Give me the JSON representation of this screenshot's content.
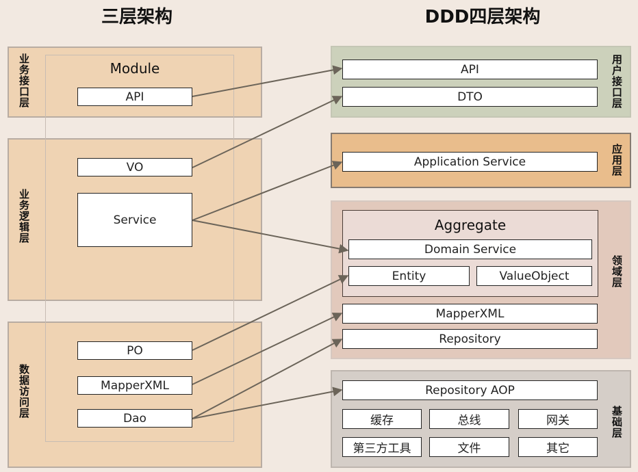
{
  "titles": {
    "left": "三层架构",
    "right": "DDD四层架构"
  },
  "three_tier": {
    "module_label": "Module",
    "layers": [
      {
        "label": "业务接口层",
        "boxes": [
          "API"
        ]
      },
      {
        "label": "业务逻辑层",
        "boxes": [
          "VO",
          "Service"
        ]
      },
      {
        "label": "数据访问层",
        "boxes": [
          "PO",
          "MapperXML",
          "Dao"
        ]
      }
    ]
  },
  "ddd": {
    "user_interface": {
      "label": "用户接口层",
      "boxes": [
        "API",
        "DTO"
      ]
    },
    "application": {
      "label": "应用层",
      "boxes": [
        "Application Service"
      ]
    },
    "domain": {
      "label": "领域层",
      "aggregate_label": "Aggregate",
      "aggregate_boxes": [
        "Domain Service",
        "Entity",
        "ValueObject"
      ],
      "boxes": [
        "MapperXML",
        "Repository"
      ]
    },
    "infrastructure": {
      "label": "基础层",
      "boxes": [
        "Repository AOP",
        "缓存",
        "总线",
        "网关",
        "第三方工具",
        "文件",
        "其它"
      ]
    }
  },
  "mappings": [
    {
      "from": "API",
      "to": "API"
    },
    {
      "from": "VO",
      "to": "DTO"
    },
    {
      "from": "Service",
      "to": "Application Service"
    },
    {
      "from": "Service",
      "to": "Domain Service"
    },
    {
      "from": "PO",
      "to": "Entity"
    },
    {
      "from": "MapperXML",
      "to": "MapperXML"
    },
    {
      "from": "Dao",
      "to": "Repository"
    },
    {
      "from": "Dao",
      "to": "Repository AOP"
    }
  ],
  "colors": {
    "background": "#f2e9e1",
    "three_tier_layer": "#efd3b3",
    "user_interface_layer": "#ccd1bb",
    "application_layer": "#e9bd8c",
    "domain_layer": "#e2c9bc",
    "infrastructure_layer": "#d5cec8",
    "arrow": "#6b6459"
  }
}
